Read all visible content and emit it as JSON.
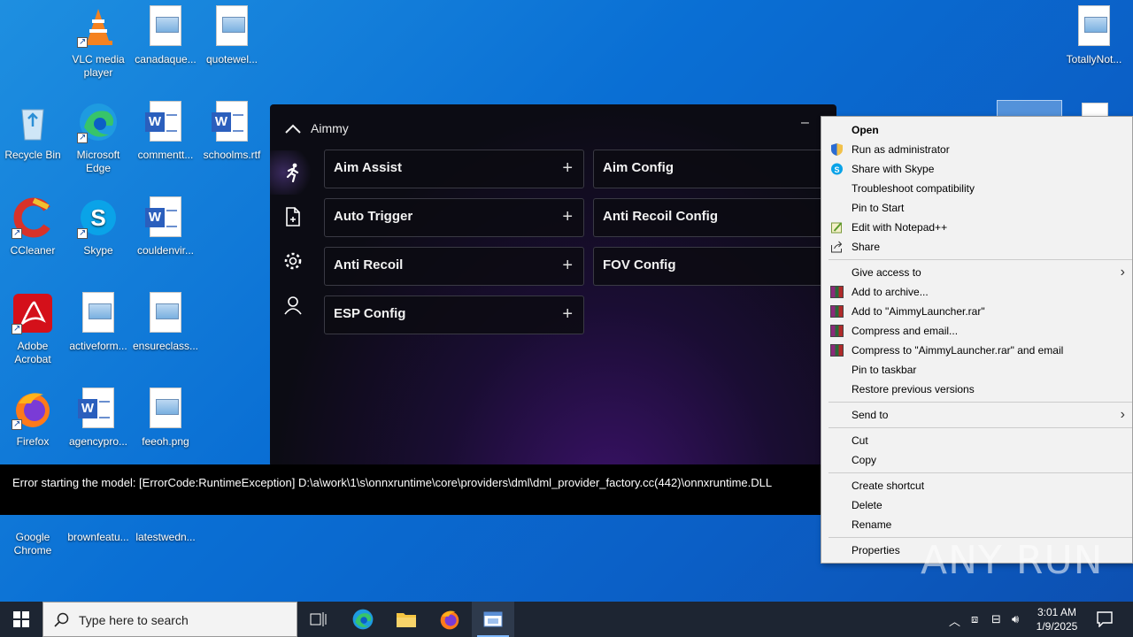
{
  "desktop": {
    "icons": [
      {
        "label": "VLC media player"
      },
      {
        "label": "canadaque..."
      },
      {
        "label": "quotewel..."
      },
      {
        "label": "Recycle Bin"
      },
      {
        "label": "Microsoft Edge"
      },
      {
        "label": "commentt..."
      },
      {
        "label": "schoolms.rtf"
      },
      {
        "label": "CCleaner"
      },
      {
        "label": "Skype"
      },
      {
        "label": "couldenvir..."
      },
      {
        "label": "Adobe Acrobat"
      },
      {
        "label": "activeform..."
      },
      {
        "label": "ensureclass..."
      },
      {
        "label": "Firefox"
      },
      {
        "label": "agencypro..."
      },
      {
        "label": "feeoh.png"
      },
      {
        "label": "Google Chrome"
      },
      {
        "label": "brownfeatu..."
      },
      {
        "label": "latestwedn..."
      },
      {
        "label": "TotallyNot..."
      }
    ]
  },
  "aimmy": {
    "title": "Aimmy",
    "minimize": "–",
    "cards": [
      {
        "label": "Aim Assist",
        "plus": "+"
      },
      {
        "label": "Aim Config"
      },
      {
        "label": "Auto Trigger",
        "plus": "+"
      },
      {
        "label": "Anti Recoil Config"
      },
      {
        "label": "Anti Recoil",
        "plus": "+"
      },
      {
        "label": "FOV Config"
      },
      {
        "label": "ESP Config",
        "plus": "+"
      }
    ]
  },
  "error": {
    "text": "Error starting the model: [ErrorCode:RuntimeException] D:\\a\\work\\1\\s\\onnxruntime\\core\\providers\\dml\\dml_provider_factory.cc(442)\\onnxruntime.DLL"
  },
  "context_menu": {
    "items": [
      {
        "label": "Open"
      },
      {
        "label": "Run as administrator"
      },
      {
        "label": "Share with Skype"
      },
      {
        "label": "Troubleshoot compatibility"
      },
      {
        "label": "Pin to Start"
      },
      {
        "label": "Edit with Notepad++"
      },
      {
        "label": "Share"
      },
      {
        "label": "Give access to"
      },
      {
        "label": "Add to archive..."
      },
      {
        "label": "Add to \"AimmyLauncher.rar\""
      },
      {
        "label": "Compress and email..."
      },
      {
        "label": "Compress to \"AimmyLauncher.rar\" and email"
      },
      {
        "label": "Pin to taskbar"
      },
      {
        "label": "Restore previous versions"
      },
      {
        "label": "Send to"
      },
      {
        "label": "Cut"
      },
      {
        "label": "Copy"
      },
      {
        "label": "Create shortcut"
      },
      {
        "label": "Delete"
      },
      {
        "label": "Rename"
      },
      {
        "label": "Properties"
      }
    ]
  },
  "taskbar": {
    "search_placeholder": "Type here to search",
    "time": "3:01 AM",
    "date": "1/9/2025"
  },
  "watermark": "ANY RUN",
  "colors": {
    "desktop_bg": "#0a6fd4",
    "taskbar_bg": "#1d2532",
    "menu_bg": "#f2f2f2",
    "aimmy_bg": "#0c0c14"
  }
}
